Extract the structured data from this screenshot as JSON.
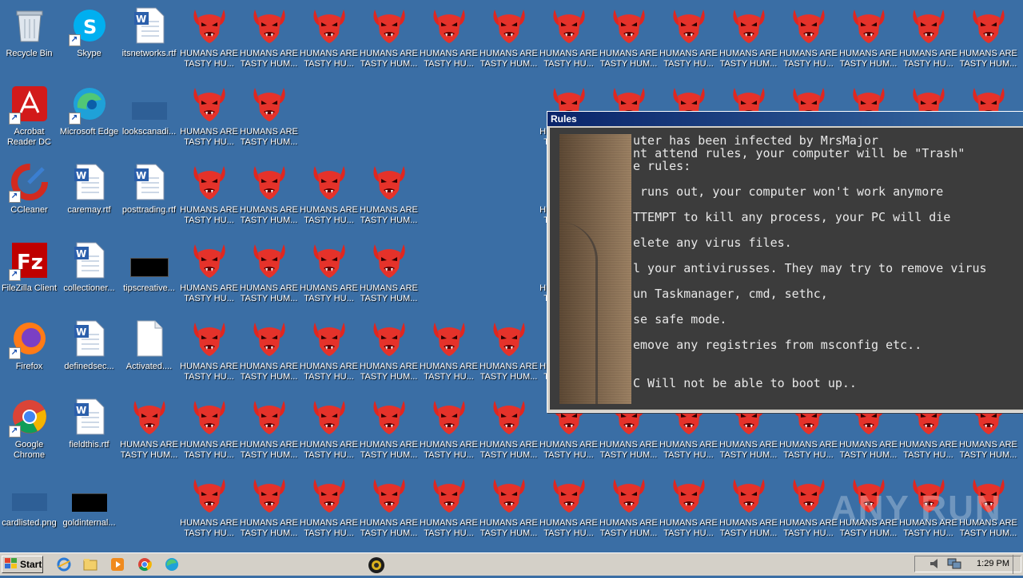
{
  "desktop": {
    "system_icons": [
      {
        "label": "Recycle Bin",
        "icon": "recycle-bin-icon"
      },
      {
        "label": "Skype",
        "icon": "skype-icon"
      },
      {
        "label": "itsnetworks.rtf",
        "icon": "word-doc-icon"
      },
      {
        "label": "Acrobat Reader DC",
        "icon": "acrobat-icon"
      },
      {
        "label": "Microsoft Edge",
        "icon": "edge-icon"
      },
      {
        "label": "lookscanadi...",
        "icon": "image-file-icon"
      },
      {
        "label": "CCleaner",
        "icon": "ccleaner-icon"
      },
      {
        "label": "caremay.rtf",
        "icon": "word-doc-icon"
      },
      {
        "label": "posttrading.rtf",
        "icon": "word-doc-icon"
      },
      {
        "label": "FileZilla Client",
        "icon": "filezilla-icon"
      },
      {
        "label": "collectioner...",
        "icon": "word-doc-icon"
      },
      {
        "label": "tipscreative...",
        "icon": "image-file-icon"
      },
      {
        "label": "Firefox",
        "icon": "firefox-icon"
      },
      {
        "label": "definedsec...",
        "icon": "word-doc-icon"
      },
      {
        "label": "Activated....",
        "icon": "blank-file-icon"
      },
      {
        "label": "Google Chrome",
        "icon": "chrome-icon"
      },
      {
        "label": "fieldthis.rtf",
        "icon": "word-doc-icon"
      },
      {
        "label": "cardlisted.png",
        "icon": "image-file-icon"
      },
      {
        "label": "goldinternal...",
        "icon": "image-file-icon"
      }
    ],
    "demon_icon_label_a": "HUMANS ARE TASTY HU...",
    "demon_icon_label_b": "HUMANS ARE TASTY HUM...",
    "demon_icon_name": "red-demon-icon"
  },
  "rules_window": {
    "title": "Rules",
    "lines": [
      "uter has been infected by MrsMajor",
      "nt attend rules, your computer will be \"Trash\"",
      "e rules:",
      " runs out, your computer won't work anymore",
      "TTEMPT to kill any process, your PC will die",
      "elete any virus files.",
      "l your antivirusses. They may try to remove virus",
      "un Taskmanager, cmd, sethc,",
      "se safe mode.",
      "emove any registries from msconfig etc..",
      "C Will not be able to boot up.."
    ]
  },
  "taskbar": {
    "start_label": "Start",
    "quick_launch": [
      "ie-icon",
      "explorer-icon",
      "media-player-icon",
      "chrome-icon",
      "edge-icon"
    ],
    "running_app_icon": "mrsmajor-app-icon",
    "clock": "1:29 PM"
  },
  "watermark": "ANY RUN"
}
